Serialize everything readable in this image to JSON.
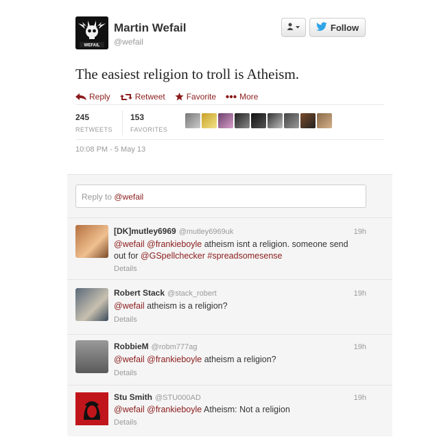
{
  "author": {
    "name": "Martin Wefail",
    "handle": "@wefail",
    "avatar_label": "WEFAIL"
  },
  "buttons": {
    "user_menu_icon": "user-dropdown-icon",
    "follow_label": "Follow"
  },
  "tweet": {
    "text": "The easiest religion to troll is Atheism.",
    "actions": {
      "reply": "Reply",
      "retweet": "Retweet",
      "favorite": "Favorite",
      "more": "More"
    },
    "stats": {
      "retweets_count": "245",
      "retweets_label": "RETWEETS",
      "favorites_count": "153",
      "favorites_label": "FAVORITES"
    },
    "timestamp": "10:08 PM - 5 May 13"
  },
  "reply_box": {
    "prefix": "Reply to ",
    "mention": "@wefail"
  },
  "replies": [
    {
      "name": "[DK]mutley6969",
      "handle": "@mutley6969uk",
      "time": "19h",
      "parts": [
        {
          "t": "@wefail",
          "m": true
        },
        {
          "t": " ",
          "m": false
        },
        {
          "t": "@frankieboyle",
          "m": true
        },
        {
          "t": " atheism isnt a religion. someone send out for ",
          "m": false
        },
        {
          "t": "@GSpellchecker",
          "m": true
        },
        {
          "t": " ",
          "m": false
        },
        {
          "t": "#spreadsomesense",
          "m": true
        }
      ],
      "details": "Details"
    },
    {
      "name": "Robert Stack",
      "handle": "@stack_robert",
      "time": "19h",
      "parts": [
        {
          "t": "@wefail",
          "m": true
        },
        {
          "t": "  atheism is a religion?",
          "m": false
        }
      ],
      "details": "Details"
    },
    {
      "name": "RobbieM",
      "handle": "@robm777ag",
      "time": "19h",
      "parts": [
        {
          "t": "@wefail",
          "m": true
        },
        {
          "t": " ",
          "m": false
        },
        {
          "t": "@frankieboyle",
          "m": true
        },
        {
          "t": " atheism a religion?",
          "m": false
        }
      ],
      "details": "Details"
    },
    {
      "name": "Stu Smith",
      "handle": "@STU000AD",
      "time": "19h",
      "parts": [
        {
          "t": "@wefail",
          "m": true
        },
        {
          "t": " ",
          "m": false
        },
        {
          "t": "@frankieboyle",
          "m": true
        },
        {
          "t": " Atheism:  Not a religion",
          "m": false
        }
      ],
      "details": "Details"
    }
  ],
  "colors": {
    "accent": "#8b1b1b",
    "muted": "#999999"
  }
}
